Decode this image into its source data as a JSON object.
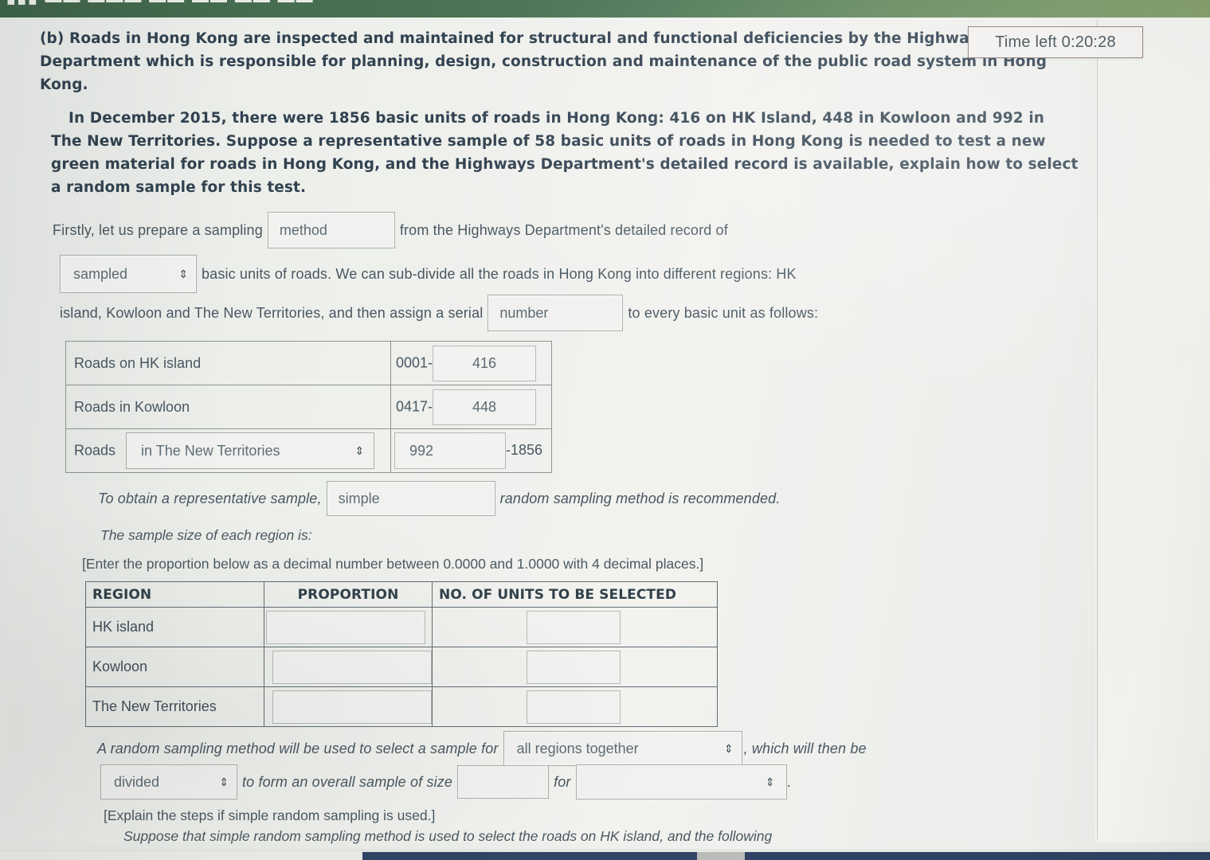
{
  "header_bar": {
    "glyph_strip": "▮▮▮  ▬▬  ▬▬▬  ▬▬   ▬▬  ▬▬  ▬▬"
  },
  "timer": {
    "label": "Time left 0:20:28"
  },
  "question": {
    "part_label": "(b)",
    "intro_paragraph": "(b) Roads in Hong Kong are inspected and maintained for structural and functional deficiencies by the Highways Department which is responsible for planning, design, construction and maintenance of the public road system in Hong Kong.",
    "scenario_paragraph": "In December 2015, there were 1856 basic units of roads in Hong Kong: 416 on HK Island, 448 in Kowloon and 992 in The New Territories. Suppose a representative sample of 58 basic units of roads in Hong Kong is needed to test a new green material for roads in Hong Kong, and the Highways Department's detailed record is available, explain how to select a random sample for this test."
  },
  "fill_lines": {
    "line1_a": "Firstly, let us prepare a sampling",
    "field_method": "method",
    "line1_b": "from the Highways Department's detailed record of",
    "select_sampled": "sampled",
    "line2_b": "basic units of roads. We can sub-divide all the roads in Hong Kong into different regions: HK",
    "line3_a": "island, Kowloon and The New Territories, and then assign a serial",
    "field_number": "number",
    "line3_b": "to every basic unit as follows:"
  },
  "serial_table": {
    "rows": [
      {
        "label": "Roads on HK island",
        "range_start": "0001-",
        "range_end": "416"
      },
      {
        "label": "Roads in Kowloon",
        "range_start": "0417-",
        "range_end": "448"
      }
    ],
    "nt_row": {
      "prefix": "Roads",
      "select_value": "in The New Territories",
      "input_value": "992",
      "suffix": "-1856"
    }
  },
  "recommend_line": {
    "before": "To obtain a representative sample,",
    "field_simple": "simple",
    "after": "random sampling method is recommended."
  },
  "sample_size_note": "The sample size of each region is:",
  "proportion_note": "[Enter the proportion below as a decimal number between 0.0000 and 1.0000 with 4 decimal places.]",
  "proportion_table": {
    "headers": [
      "REGION",
      "PROPORTION",
      "NO. OF UNITS TO BE SELECTED"
    ],
    "rows": [
      {
        "region": "HK island",
        "proportion": "",
        "units": ""
      },
      {
        "region": "Kowloon",
        "proportion": "",
        "units": ""
      },
      {
        "region": "The New Territories",
        "proportion": "",
        "units": ""
      }
    ]
  },
  "closing_lines": {
    "a1": "A random sampling method will be used to select a sample for",
    "select_scope": "all regions together",
    "a2": ", which will then be",
    "select_divided": "divided",
    "b1": "to form an overall sample of size",
    "field_size": "",
    "b2": "for",
    "select_for": "",
    "b3": "."
  },
  "explain_note": "[Explain the steps if simple random sampling is used.]",
  "suppose_line": "Suppose that simple random sampling method is used to select the roads on HK island, and the following",
  "icons": {
    "select_arrows": "⇕"
  },
  "colors": {
    "green_bar": "#4f7a57",
    "page_bg": "#eef0ec",
    "bold_text": "#2e3f4e",
    "body_text": "#46555f",
    "field_border": "#a9aeab",
    "field_bg": "#f2f3f1",
    "timer_border": "#8e7a7a",
    "taskbar_navy": "#2c3f61"
  }
}
